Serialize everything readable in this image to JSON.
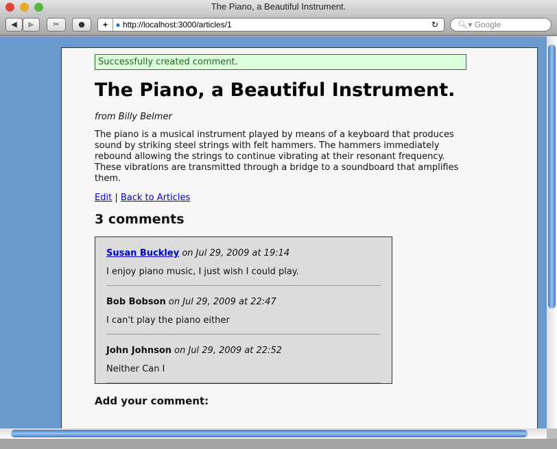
{
  "window": {
    "title": "The Piano, a Beautiful Instrument."
  },
  "toolbar": {
    "url": "http://localhost:3000/articles/1",
    "search_placeholder": "Google"
  },
  "page": {
    "flash": "Successfully created comment.",
    "title": "The Piano, a Beautiful Instrument.",
    "byline": "from Billy Belmer",
    "body": "The piano is a musical instrument played by means of a keyboard that produces sound by striking steel strings with felt hammers. The hammers immediately rebound allowing the strings to continue vibrating at their resonant frequency. These vibrations are transmitted through a bridge to a soundboard that amplifies them.",
    "edit_link": "Edit",
    "separator": "|",
    "back_link": "Back to Articles",
    "comments_heading": "3 comments",
    "comments": [
      {
        "author": "Susan Buckley",
        "date": "on Jul 29, 2009 at 19:14",
        "text": "I enjoy piano music, I just wish I could play."
      },
      {
        "author": "Bob Bobson",
        "date": "on Jul 29, 2009 at 22:47",
        "text": "I can't play the piano either"
      },
      {
        "author": "John Johnson",
        "date": "on Jul 29, 2009 at 22:52",
        "text": "Neither Can I"
      }
    ],
    "add_comment_heading": "Add your comment:"
  }
}
